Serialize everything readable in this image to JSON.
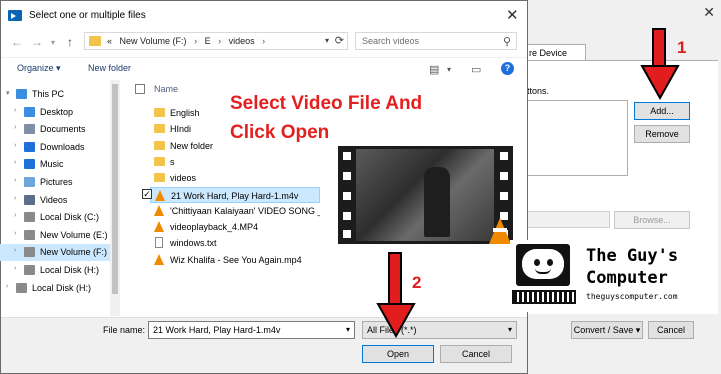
{
  "dialog": {
    "title": "Select one or multiple files",
    "address": {
      "overflow": "«",
      "crumbs": [
        "New Volume (F:)",
        "E",
        "videos"
      ],
      "separator": "›"
    },
    "search_placeholder": "Search videos",
    "toolbar": {
      "organize": "Organize ▾",
      "new_folder": "New folder",
      "help": "?"
    },
    "sidebar": [
      {
        "label": "This PC",
        "icon": "pc-icon",
        "color": "#3b8de0",
        "level": 0,
        "expand": "▾"
      },
      {
        "label": "Desktop",
        "icon": "desktop-icon",
        "color": "#3b8de0",
        "level": 1,
        "expand": "›"
      },
      {
        "label": "Documents",
        "icon": "documents-icon",
        "color": "#7f8fa6",
        "level": 1,
        "expand": "›"
      },
      {
        "label": "Downloads",
        "icon": "downloads-icon",
        "color": "#1e6fd9",
        "level": 1,
        "expand": "›"
      },
      {
        "label": "Music",
        "icon": "music-icon",
        "color": "#1e6fd9",
        "level": 1,
        "expand": "›"
      },
      {
        "label": "Pictures",
        "icon": "pictures-icon",
        "color": "#6da5dc",
        "level": 1,
        "expand": "›"
      },
      {
        "label": "Videos",
        "icon": "videos-icon",
        "color": "#5b6e8a",
        "level": 1,
        "expand": "›"
      },
      {
        "label": "Local Disk (C:)",
        "icon": "drive-icon",
        "color": "#8a8a8a",
        "level": 1,
        "expand": "›"
      },
      {
        "label": "New Volume (E:)",
        "icon": "drive-icon",
        "color": "#8a8a8a",
        "level": 1,
        "expand": "›"
      },
      {
        "label": "New Volume (F:)",
        "icon": "drive-icon",
        "color": "#8a8a8a",
        "level": 1,
        "expand": "›",
        "selected": true
      },
      {
        "label": "Local Disk (H:)",
        "icon": "drive-icon",
        "color": "#8a8a8a",
        "level": 1,
        "expand": "›"
      },
      {
        "label": "Local Disk (H:)",
        "icon": "drive-icon",
        "color": "#8a8a8a",
        "level": 0,
        "expand": "›"
      }
    ],
    "column_name": "Name",
    "files": [
      {
        "name": "English",
        "type": "folder"
      },
      {
        "name": "HIndi",
        "type": "folder"
      },
      {
        "name": "New folder",
        "type": "folder"
      },
      {
        "name": "s",
        "type": "folder"
      },
      {
        "name": "videos",
        "type": "folder"
      },
      {
        "name": "21 Work Hard, Play Hard-1.m4v",
        "type": "vlc",
        "selected": true
      },
      {
        "name": "'Chittiyaan Kalaiyaan' VIDEO SONG _",
        "type": "vlc"
      },
      {
        "name": "videoplayback_4.MP4",
        "type": "vlc"
      },
      {
        "name": "windows.txt",
        "type": "txt"
      },
      {
        "name": "Wiz Khalifa - See You Again.mp4",
        "type": "vlc"
      }
    ],
    "annotation": [
      "Select Video File And",
      "Click Open"
    ],
    "filename_label": "File name:",
    "filename_value": "21 Work Hard, Play Hard-1.m4v",
    "filter_value": "All Files (*.*)",
    "open": "Open",
    "cancel": "Cancel"
  },
  "vlc_dialog": {
    "tab": "re Device",
    "buttons_text": "uttons.",
    "add": "Add...",
    "remove": "Remove",
    "browse": "Browse...",
    "convert_save": "Convert / Save ▾",
    "cancel": "Cancel"
  },
  "markers": {
    "one": "1",
    "two": "2"
  },
  "logo": {
    "line1": "The Guy's",
    "line2": "Computer",
    "url": "theguyscomputer.com"
  },
  "colors": {
    "annotation": "#e32020",
    "arrow": "#e11d1d",
    "selection": "#cce8ff",
    "accent": "#0078d7"
  }
}
